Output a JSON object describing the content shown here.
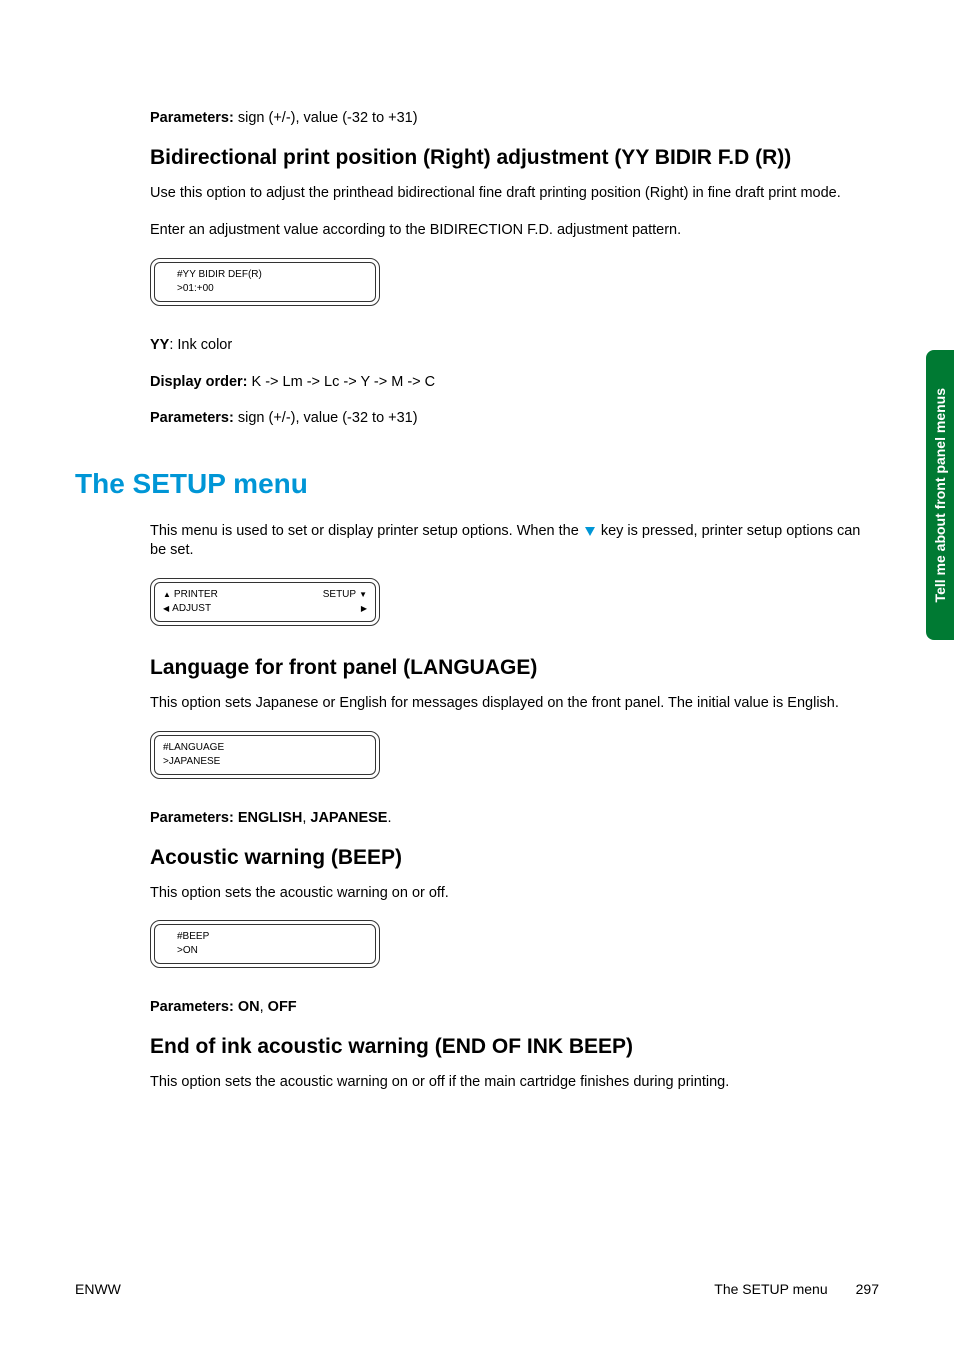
{
  "side_tab": "Tell me about front panel menus",
  "top_param": {
    "label": "Parameters:",
    "value": "sign (+/-), value (-32 to +31)"
  },
  "bidir_r": {
    "heading": "Bidirectional print position (Right) adjustment (YY BIDIR F.D (R))",
    "p1": "Use this option to adjust the printhead bidirectional fine draft printing position (Right) in fine draft print mode.",
    "p2": "Enter an adjustment value according to the BIDIRECTION F.D. adjustment pattern.",
    "lcd_line1": "#YY BIDIR DEF(R)",
    "lcd_line2": ">01:+00",
    "yy_label": "YY",
    "yy_desc": ": Ink color",
    "order_label": "Display order:",
    "order_value": "K -> Lm -> Lc -> Y -> M -> C",
    "param_label": "Parameters:",
    "param_value": "sign (+/-), value (-32 to +31)"
  },
  "setup": {
    "heading": "The SETUP menu",
    "intro_before": "This menu is used to set or display printer setup options. When the ",
    "intro_after": " key is pressed, printer setup options can be set.",
    "lcd_row1_left": "PRINTER",
    "lcd_row1_right": "SETUP",
    "lcd_row2_left": "ADJUST"
  },
  "language": {
    "heading": "Language for front panel (LANGUAGE)",
    "p1": "This option sets Japanese or English for messages displayed on the front panel. The initial value is English.",
    "lcd_line1": "#LANGUAGE",
    "lcd_line2": ">JAPANESE",
    "param_label": "Parameters: ENGLISH",
    "param_sep": ", ",
    "param_value": "JAPANESE",
    "param_end": "."
  },
  "beep": {
    "heading": "Acoustic warning (BEEP)",
    "p1": "This option sets the acoustic warning on or off.",
    "lcd_line1": "#BEEP",
    "lcd_line2": ">ON",
    "param_label": "Parameters: ON",
    "param_sep": ", ",
    "param_value": "OFF"
  },
  "endink": {
    "heading": "End of ink acoustic warning (END OF INK BEEP)",
    "p1": "This option sets the acoustic warning on or off if the main cartridge finishes during printing."
  },
  "footer": {
    "left": "ENWW",
    "right_label": "The SETUP menu",
    "page": "297"
  }
}
